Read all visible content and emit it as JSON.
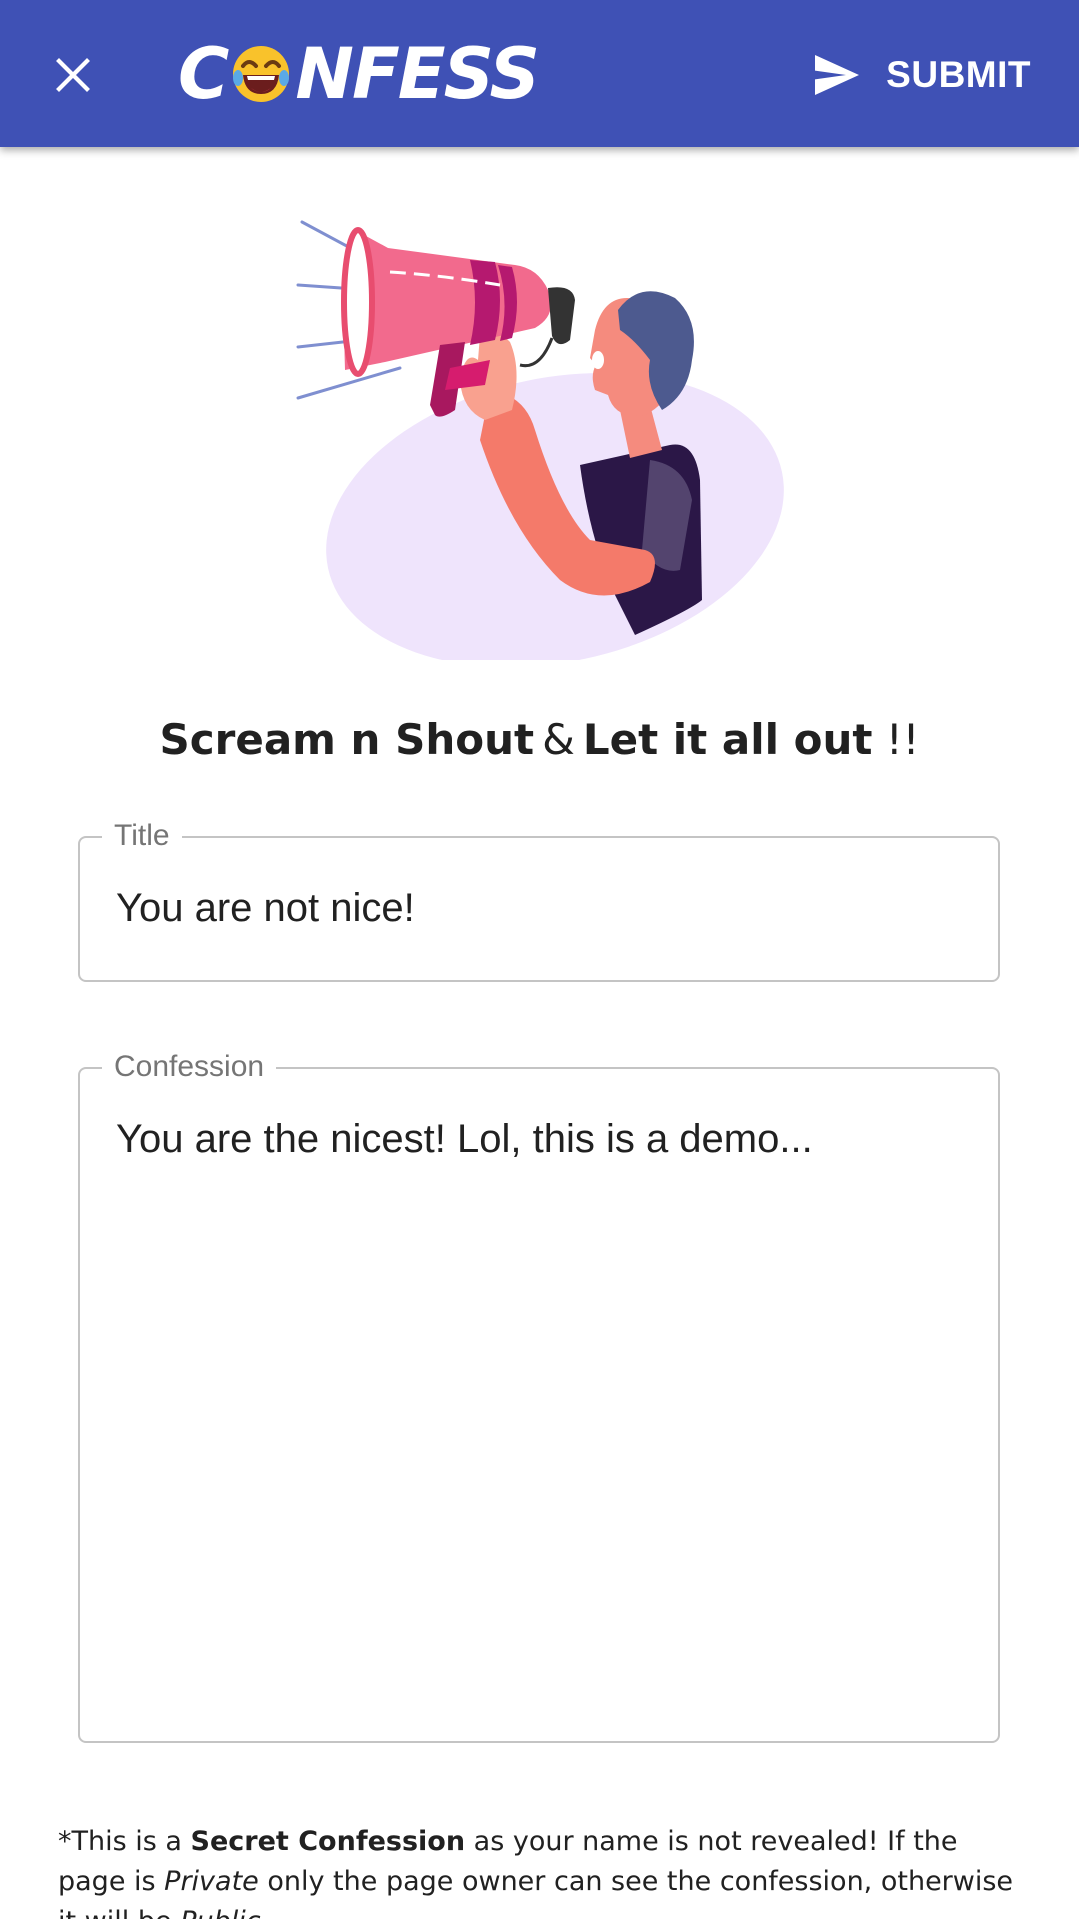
{
  "appbar": {
    "logo_prefix": "C",
    "logo_suffix": "NFESS",
    "logo_emoji_icon": "laughing-face-emoji",
    "submit_label": "SUBMIT",
    "close_icon": "close-icon",
    "send_icon": "send-icon",
    "bg_color": "#3f51b5"
  },
  "illustration": {
    "icon": "person-with-megaphone-illustration"
  },
  "headline": {
    "part1": "Scream n Shout",
    "amp": "&",
    "part2": "Let it all out",
    "part3": "!!"
  },
  "form": {
    "title_label": "Title",
    "title_value": "You are not nice!",
    "confession_label": "Confession",
    "confession_value": "You are the nicest! Lol, this is a demo..."
  },
  "footnote": {
    "prefix": "*This is a ",
    "bold": "Secret Confession",
    "middle": " as your name is not revealed! If the page is ",
    "italic_private": "Private",
    "rest": " only the page owner can see the confession, otherwise it will be ",
    "italic_public": "Public",
    "end": "."
  }
}
